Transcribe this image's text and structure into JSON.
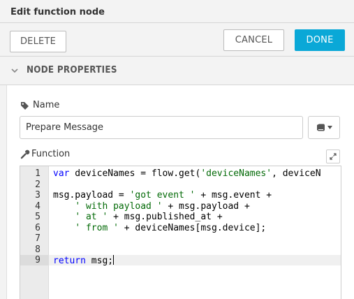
{
  "window": {
    "title": "Edit function node"
  },
  "toolbar": {
    "delete_label": "DELETE",
    "cancel_label": "CANCEL",
    "done_label": "DONE"
  },
  "section": {
    "title": "NODE PROPERTIES"
  },
  "fields": {
    "name_label": "Name",
    "name_value": "Prepare Message",
    "function_label": "Function"
  },
  "icons": {
    "section_toggle": "chevron-down-icon",
    "name": "tag-icon",
    "function": "wrench-icon",
    "library": "book-icon",
    "library_menu": "caret-down-icon",
    "expand": "expand-icon"
  },
  "colors": {
    "done_button": "#0aa8d7",
    "keyword": "#0000ff",
    "string": "#036a07"
  },
  "editor": {
    "cursor_line": 9,
    "lines": [
      {
        "num": "1",
        "segments": [
          {
            "t": "var",
            "c": "kw"
          },
          {
            "t": " deviceNames = flow.get("
          },
          {
            "t": "'deviceNames'",
            "c": "str"
          },
          {
            "t": ", deviceN"
          }
        ]
      },
      {
        "num": "2",
        "segments": []
      },
      {
        "num": "3",
        "segments": [
          {
            "t": "msg.payload = "
          },
          {
            "t": "'got event '",
            "c": "str"
          },
          {
            "t": " + msg.event +"
          }
        ]
      },
      {
        "num": "4",
        "segments": [
          {
            "t": "    "
          },
          {
            "t": "' with payload '",
            "c": "str"
          },
          {
            "t": " + msg.payload +"
          }
        ]
      },
      {
        "num": "5",
        "segments": [
          {
            "t": "    "
          },
          {
            "t": "' at '",
            "c": "str"
          },
          {
            "t": " + msg.published_at +"
          }
        ]
      },
      {
        "num": "6",
        "segments": [
          {
            "t": "    "
          },
          {
            "t": "' from '",
            "c": "str"
          },
          {
            "t": " + deviceNames[msg.device];"
          }
        ]
      },
      {
        "num": "7",
        "segments": []
      },
      {
        "num": "8",
        "segments": []
      },
      {
        "num": "9",
        "segments": [
          {
            "t": "return",
            "c": "kw"
          },
          {
            "t": " msg;"
          }
        ]
      }
    ]
  }
}
